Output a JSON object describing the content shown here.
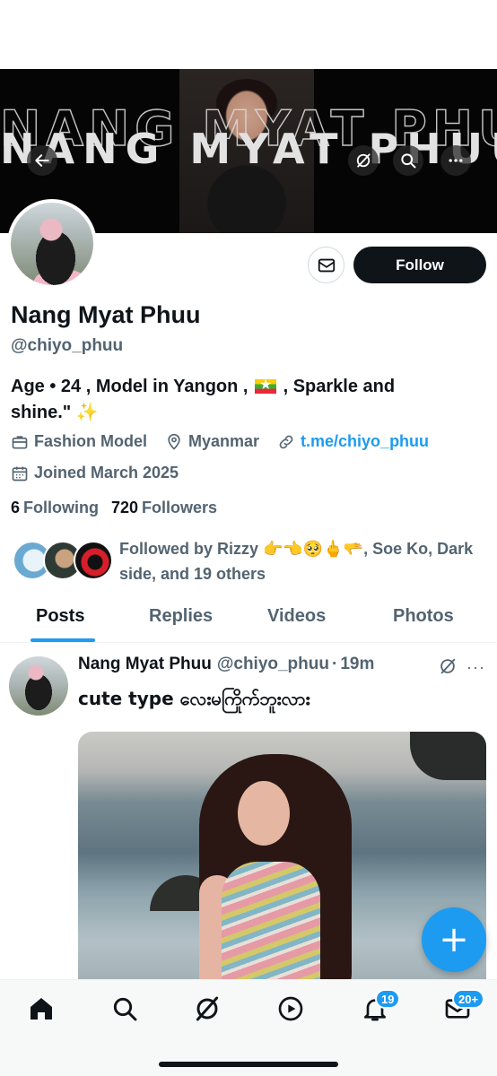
{
  "banner": {
    "text": "NANG MYAT PHUU",
    "icons": [
      "back-arrow-icon",
      "grok-icon",
      "search-icon",
      "more-icon"
    ]
  },
  "profile": {
    "name": "Nang Myat Phuu",
    "handle": "@chiyo_phuu",
    "bio_part1": "Age • 24 , Model in Yangon ,",
    "bio_part2": ", Sparkle and shine.\"",
    "bio_sparkle": "✨",
    "profession": "Fashion Model",
    "location": "Myanmar",
    "link": "t.me/chiyo_phuu",
    "joined": "Joined March 2025",
    "following_count": "6",
    "following_label": "Following",
    "followers_count": "720",
    "followers_label": "Followers",
    "followed_by": "Followed by Rizzy 👉👈🥺🖕🫳, Soe Ko, Dark side, and 19 others"
  },
  "actions": {
    "follow_label": "Follow"
  },
  "tabs": [
    {
      "label": "Posts",
      "active": true
    },
    {
      "label": "Replies",
      "active": false
    },
    {
      "label": "Videos",
      "active": false
    },
    {
      "label": "Photos",
      "active": false
    }
  ],
  "post": {
    "name": "Nang Myat Phuu",
    "handle": "@chiyo_phuu",
    "separator": "·",
    "time": "19m",
    "more": "···",
    "text": "cute type လေးမကြိုက်ဘူးလား"
  },
  "fab": {
    "label": "+"
  },
  "nav": {
    "notifications_badge": "19",
    "messages_badge": "20+"
  },
  "colors": {
    "accent": "#1d9bf0",
    "text_primary": "#0f1419",
    "text_secondary": "#536471"
  }
}
